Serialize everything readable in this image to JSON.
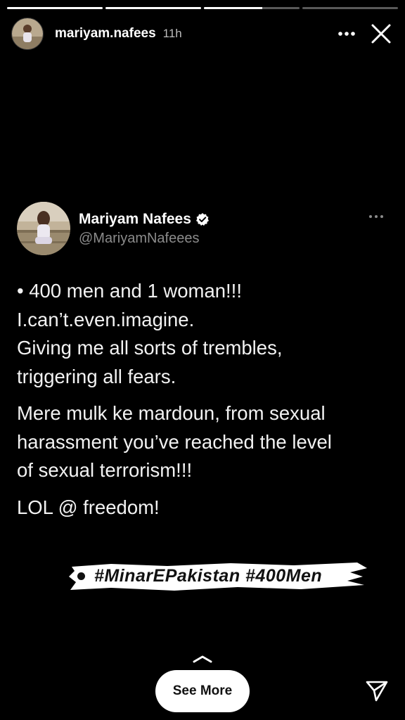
{
  "story": {
    "progress": [
      1,
      1,
      0.61,
      0
    ],
    "username": "mariyam.nafees",
    "time": "11h"
  },
  "tweet": {
    "display_name": "Mariyam Nafees",
    "handle": "@MariyamNafeees",
    "lines": [
      "• 400 men and 1 woman!!!",
      "I.can’t.even.imagine.",
      "Giving me all sorts of trembles,",
      "triggering all fears."
    ],
    "para2": [
      "Mere mulk ke mardoun, from sexual",
      "harassment you’ve reached the level",
      "of sexual terrorism!!!"
    ],
    "para3": "LOL @ freedom!"
  },
  "sticker": {
    "text": "#MinarEPakistan #400Men"
  },
  "footer": {
    "see_more_label": "See More"
  },
  "icons": {
    "more": "more-horizontal-icon",
    "close": "close-icon",
    "verified": "verified-badge-icon",
    "chevron": "chevron-up-icon",
    "send": "send-icon"
  },
  "colors": {
    "background": "#000000",
    "handle": "#8b8b8b",
    "verified": "#ffffff"
  }
}
